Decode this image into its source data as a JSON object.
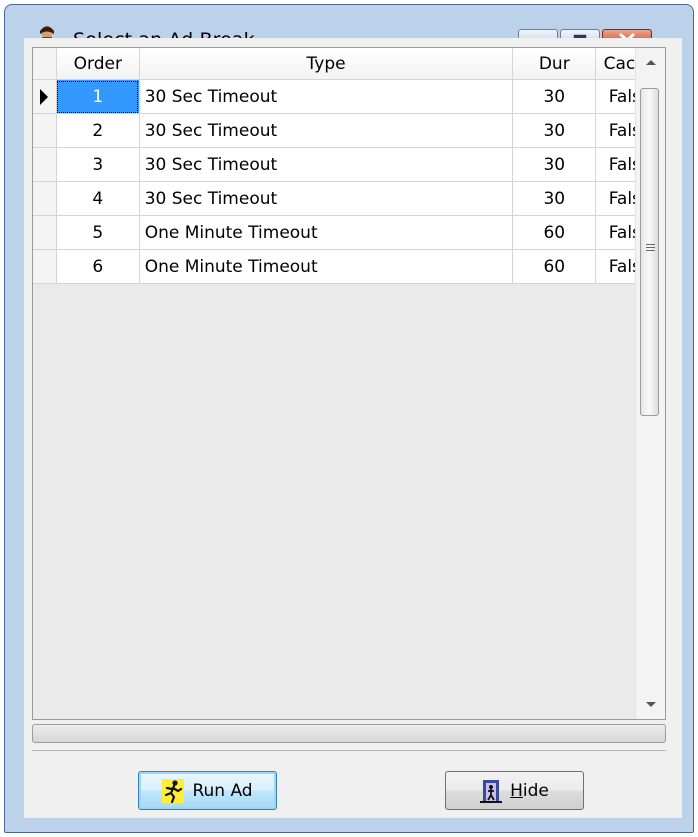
{
  "window": {
    "title": "Select an Ad Break",
    "icon": "ad-break-app-icon",
    "buttons": {
      "minimize": "minimize-icon",
      "maximize": "maximize-icon",
      "close": "close-icon"
    }
  },
  "grid": {
    "columns": [
      "Order",
      "Type",
      "Dur",
      "Cache"
    ],
    "rows": [
      {
        "order": "1",
        "type": "30 Sec Timeout",
        "dur": "30",
        "cache": "False"
      },
      {
        "order": "2",
        "type": "30 Sec Timeout",
        "dur": "30",
        "cache": "False"
      },
      {
        "order": "3",
        "type": "30 Sec Timeout",
        "dur": "30",
        "cache": "False"
      },
      {
        "order": "4",
        "type": "30 Sec Timeout",
        "dur": "30",
        "cache": "False"
      },
      {
        "order": "5",
        "type": "One Minute Timeout",
        "dur": "60",
        "cache": "False"
      },
      {
        "order": "6",
        "type": "One Minute Timeout",
        "dur": "60",
        "cache": "False"
      }
    ],
    "current_row": "1"
  },
  "actions": {
    "run_ad": {
      "label": "Run Ad",
      "icon": "running-man-icon"
    },
    "hide": {
      "label_accel": "H",
      "label_rest": "ide",
      "icon": "exit-door-icon"
    }
  },
  "colors": {
    "window_frame": "#bcd2ea",
    "selection": "#3399ff",
    "close_button": "#c6401c",
    "focused_button_border": "#3c7fb1"
  }
}
